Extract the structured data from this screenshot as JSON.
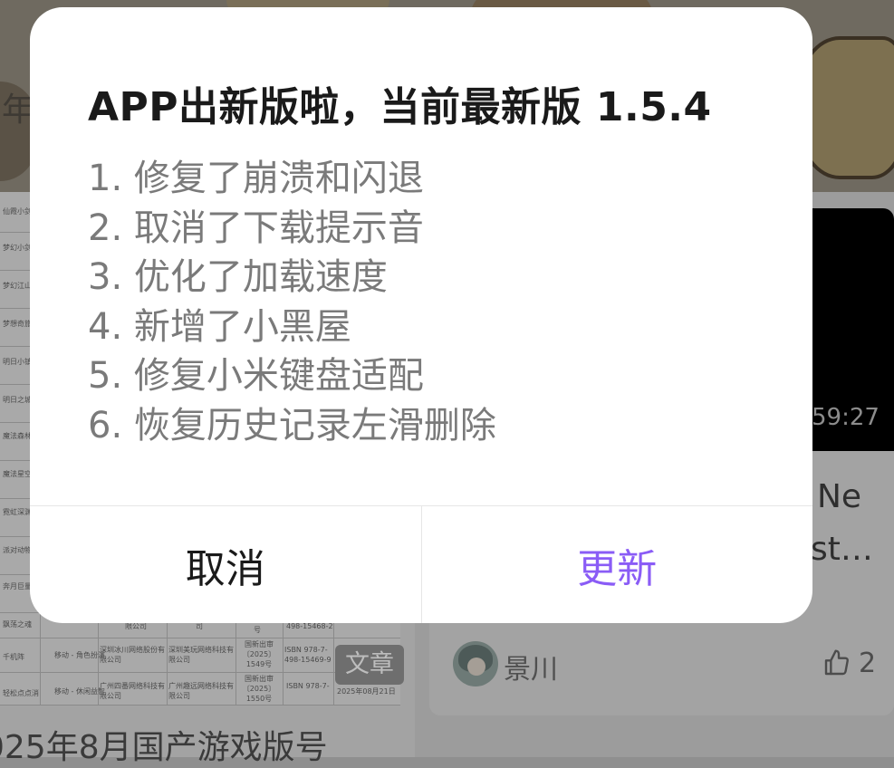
{
  "dialog": {
    "title": "APP出新版啦，当前最新版 1.5.4",
    "changes": [
      "1. 修复了崩溃和闪退",
      "2. 取消了下载提示音",
      "3. 优化了加载速度",
      "4. 新增了小黑屋",
      "5. 修复小米键盘适配",
      "6. 恢复历史记录左滑删除"
    ],
    "cancel_label": "取消",
    "update_label": "更新",
    "accent_color": "#8a5cf6"
  },
  "background": {
    "banner_partial_text": "年",
    "left_card": {
      "tag": "文章",
      "title_partial": "025年8月国产游戏版号",
      "doc_names": [
        "仙霞小剑",
        "梦幻小剑",
        "梦幻江山",
        "梦想奇旅",
        "明日小镇",
        "明日之城",
        "魔法森林",
        "魔法星空",
        "霓虹深渊",
        "派对动物",
        "奔月巨量",
        "飘荡之魂",
        "千机阵",
        "轻松点点消"
      ],
      "doc_cells": {
        "type_row_a": "移动 - 角色扮演",
        "type_row_b": "移动 - 休闲益智",
        "company_row_a": "深圳冰川网络股份有限公司",
        "company_row_b": "广州四番网络科技有限公司",
        "publisher_row_a": "深圳美玩网络科技有限公司",
        "publisher_row_b": "广州趣远网络科技有限公司",
        "approval_row_a": "国新出审〔2025〕1549号",
        "approval_row_b": "国新出审〔2025〕1550号",
        "isbn_row_a": "ISBN 978-7-498-15469-9",
        "isbn_row_b": "ISBN 978-7-",
        "isbn_row_prev": "498-15468-2",
        "date_row_b": "2025年08月21日",
        "partial_company_prev": "限公司",
        "partial_publisher_prev": "司",
        "partial_approval_prev": "号"
      }
    },
    "right_card": {
      "video_time_partial": "59:27",
      "title_line1_partial": "Ne",
      "title_line2_partial": "st…",
      "author": "景川",
      "likes": "2"
    }
  }
}
